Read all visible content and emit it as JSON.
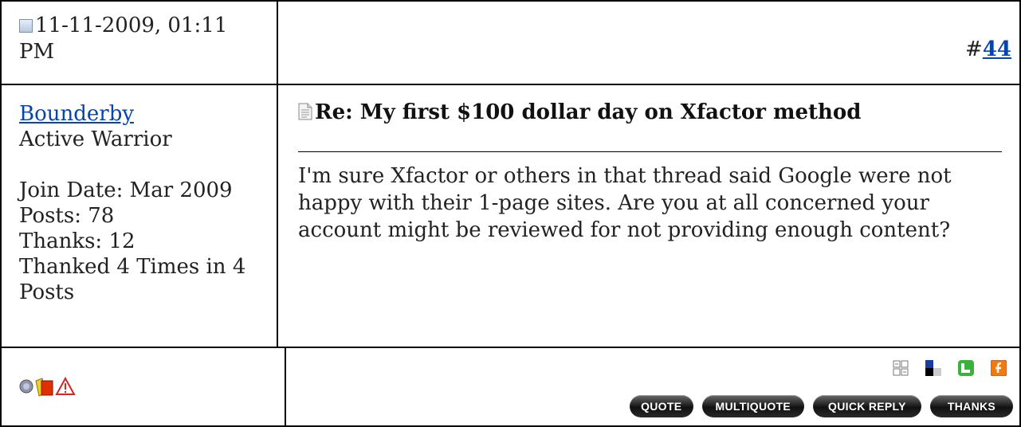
{
  "post": {
    "date": "11-11-2009, 01:11 PM",
    "number_prefix": "#",
    "number": "44",
    "title": "Re: My first $100 dollar day on Xfactor method",
    "message": "I'm sure Xfactor or others in that thread said Google were not happy with their 1-page sites. Are you at all concerned your account might be reviewed for not providing enough content?"
  },
  "user": {
    "name": "Bounderby",
    "rank": "Active Warrior",
    "join_date": "Join Date: Mar 2009",
    "posts": "Posts: 78",
    "thanks": "Thanks: 12",
    "thanked": "Thanked 4 Times in 4 Posts"
  },
  "icons": {
    "status": [
      "offline-status-icon",
      "reputation-icon",
      "report-post-icon"
    ],
    "share": [
      "social-share-icon",
      "delicious-icon",
      "technorati-icon",
      "furl-icon"
    ]
  },
  "buttons": {
    "quote": "QUOTE",
    "multiquote": "MULTIQUOTE",
    "quick_reply": "QUICK REPLY",
    "thanks": "THANKS"
  },
  "colors": {
    "link": "#0645ad",
    "border": "#000000",
    "button": "#111111"
  }
}
